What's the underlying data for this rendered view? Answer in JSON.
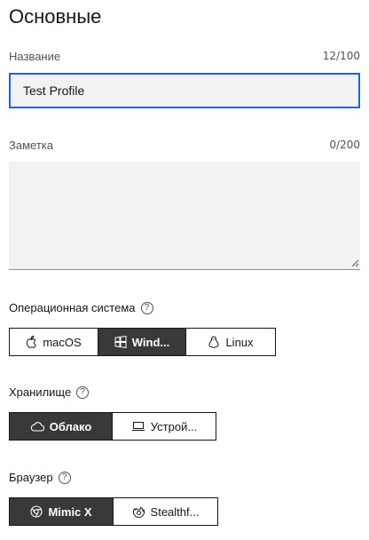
{
  "section_title": "Основные",
  "name_field": {
    "label": "Название",
    "counter": "12/100",
    "value": "Test Profile"
  },
  "note_field": {
    "label": "Заметка",
    "counter": "0/200",
    "value": ""
  },
  "os": {
    "label": "Операционная система",
    "help": "?",
    "options": [
      {
        "label": "macOS",
        "icon": "apple-icon",
        "selected": false
      },
      {
        "label": "Wind...",
        "icon": "windows-icon",
        "selected": true
      },
      {
        "label": "Linux",
        "icon": "linux-icon",
        "selected": false
      }
    ]
  },
  "storage": {
    "label": "Хранилище",
    "help": "?",
    "options": [
      {
        "label": "Облако",
        "icon": "cloud-icon",
        "selected": true
      },
      {
        "label": "Устрой...",
        "icon": "laptop-icon",
        "selected": false
      }
    ]
  },
  "browser": {
    "label": "Браузер",
    "help": "?",
    "options": [
      {
        "label": "Mimic X",
        "icon": "chromium-icon",
        "selected": true
      },
      {
        "label": "Stealthf...",
        "icon": "firefox-icon",
        "selected": false
      }
    ]
  },
  "colors": {
    "accent": "#0f62fe",
    "selected_bg": "#393939",
    "field_bg": "#f2f2f2"
  }
}
